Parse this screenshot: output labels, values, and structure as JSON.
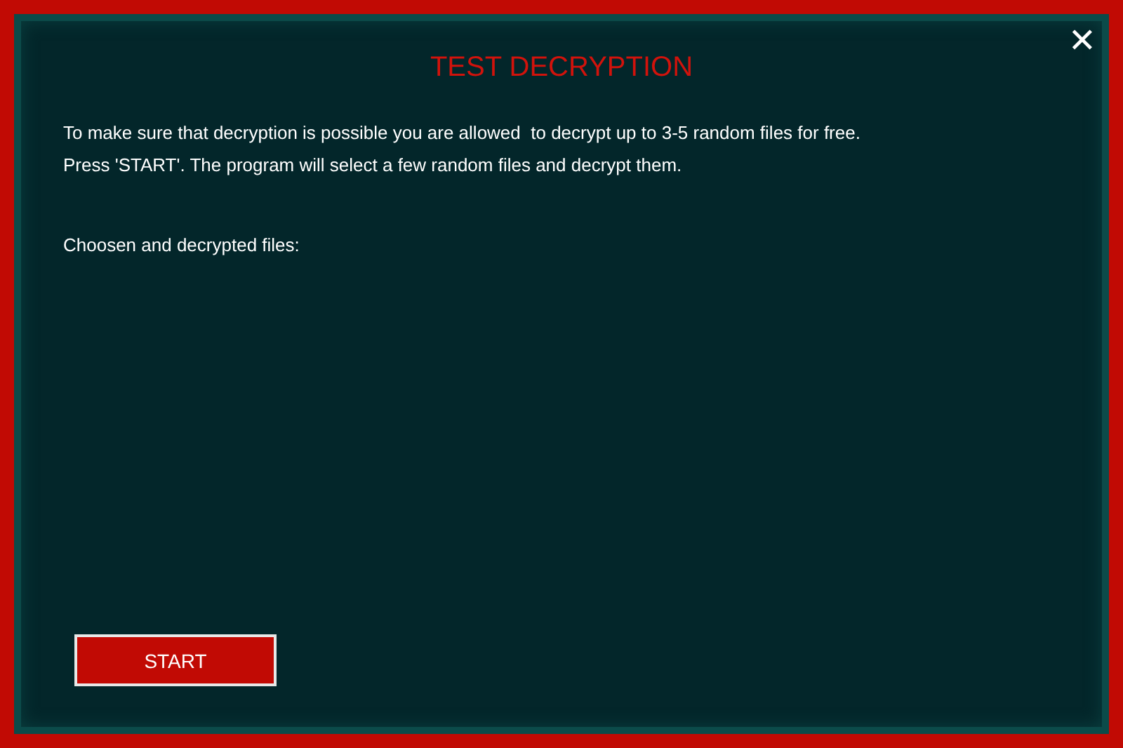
{
  "dialog": {
    "title": "TEST DECRYPTION",
    "close": "✕",
    "paragraphs": [
      "To make sure that decryption is possible you are allowed  to decrypt up to 3-5 random files for free.",
      "Press 'START'. The program will select a few random files and decrypt them."
    ],
    "files_label": "Choosen and decrypted files:",
    "button": "START"
  }
}
